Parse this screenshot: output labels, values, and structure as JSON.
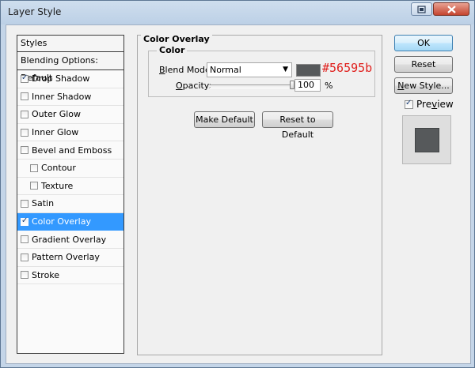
{
  "window": {
    "title": "Layer Style"
  },
  "styles_panel": {
    "header": "Styles",
    "blending_options": "Blending Options: Default",
    "items": [
      {
        "label": "Drop Shadow",
        "checked": true,
        "selected": false,
        "indent": false
      },
      {
        "label": "Inner Shadow",
        "checked": false,
        "selected": false,
        "indent": false
      },
      {
        "label": "Outer Glow",
        "checked": false,
        "selected": false,
        "indent": false
      },
      {
        "label": "Inner Glow",
        "checked": false,
        "selected": false,
        "indent": false
      },
      {
        "label": "Bevel and Emboss",
        "checked": false,
        "selected": false,
        "indent": false
      },
      {
        "label": "Contour",
        "checked": false,
        "selected": false,
        "indent": true
      },
      {
        "label": "Texture",
        "checked": false,
        "selected": false,
        "indent": true
      },
      {
        "label": "Satin",
        "checked": false,
        "selected": false,
        "indent": false
      },
      {
        "label": "Color Overlay",
        "checked": true,
        "selected": true,
        "indent": false
      },
      {
        "label": "Gradient Overlay",
        "checked": false,
        "selected": false,
        "indent": false
      },
      {
        "label": "Pattern Overlay",
        "checked": false,
        "selected": false,
        "indent": false
      },
      {
        "label": "Stroke",
        "checked": false,
        "selected": false,
        "indent": false
      }
    ]
  },
  "color_overlay": {
    "section_title": "Color Overlay",
    "group_title": "Color",
    "blend_mode_label": "Blend Mode:",
    "blend_mode_value": "Normal",
    "color_hex": "#56595b",
    "color_annotation": "#56595b",
    "opacity_label": "Opacity:",
    "opacity_value": "100",
    "opacity_unit": "%",
    "make_default_label": "Make Default",
    "reset_default_label": "Reset to Default"
  },
  "actions": {
    "ok_label": "OK",
    "reset_label": "Reset",
    "new_style_label": "New Style...",
    "preview_label": "Preview",
    "preview_checked": true
  },
  "colors": {
    "selection": "#3399ff",
    "overlay_color": "#56595b",
    "annotation": "#e0201d"
  },
  "icons": {
    "help": "help-icon",
    "close": "close-icon"
  }
}
